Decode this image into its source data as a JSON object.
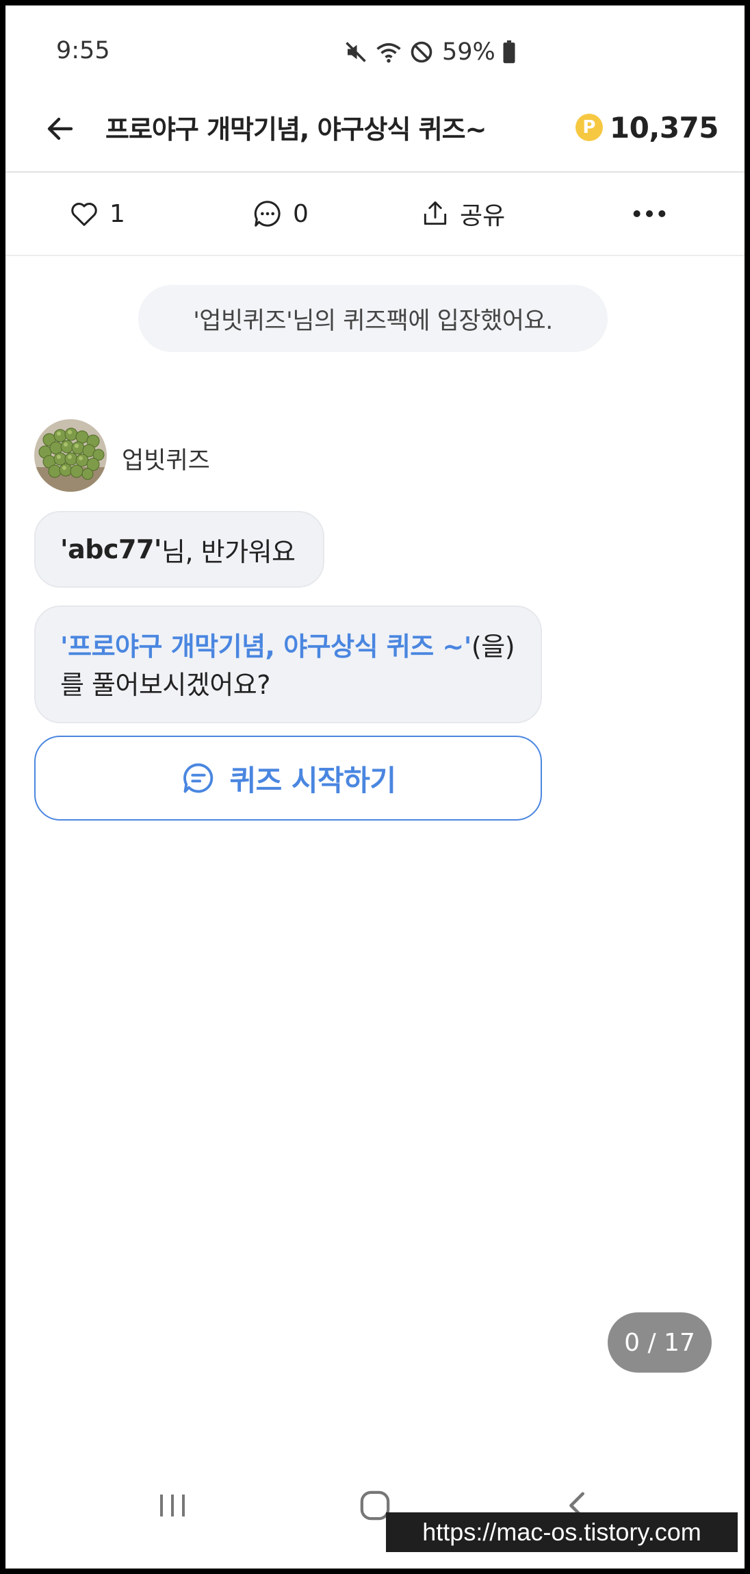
{
  "status_bar": {
    "time": "9:55",
    "battery": "59%"
  },
  "header": {
    "title": "프로야구 개막기념, 야구상식 퀴즈~",
    "point_symbol": "P",
    "points": "10,375"
  },
  "actions": {
    "like_count": "1",
    "comment_count": "0",
    "share_label": "공유"
  },
  "notice": {
    "text": "'업빗퀴즈'님의 퀴즈팩에 입장했어요."
  },
  "sender": {
    "name": "업빗퀴즈"
  },
  "messages": {
    "greeting_user": "'abc77'",
    "greeting_rest": "님, 반가워요",
    "quiz_name": "'프로야구 개막기념, 야구상식 퀴즈 ~'",
    "question_rest": "(을)를 풀어보시겠어요?"
  },
  "start_button": {
    "label": "퀴즈 시작하기"
  },
  "progress": {
    "text": "0 / 17",
    "current": 0,
    "total": 17
  },
  "watermark": {
    "text": "https://mac-os.tistory.com"
  },
  "colors": {
    "accent": "#4a86e0",
    "coin": "#f6c842",
    "bubble": "#f0f2f6",
    "pill": "#8c8c8c"
  }
}
